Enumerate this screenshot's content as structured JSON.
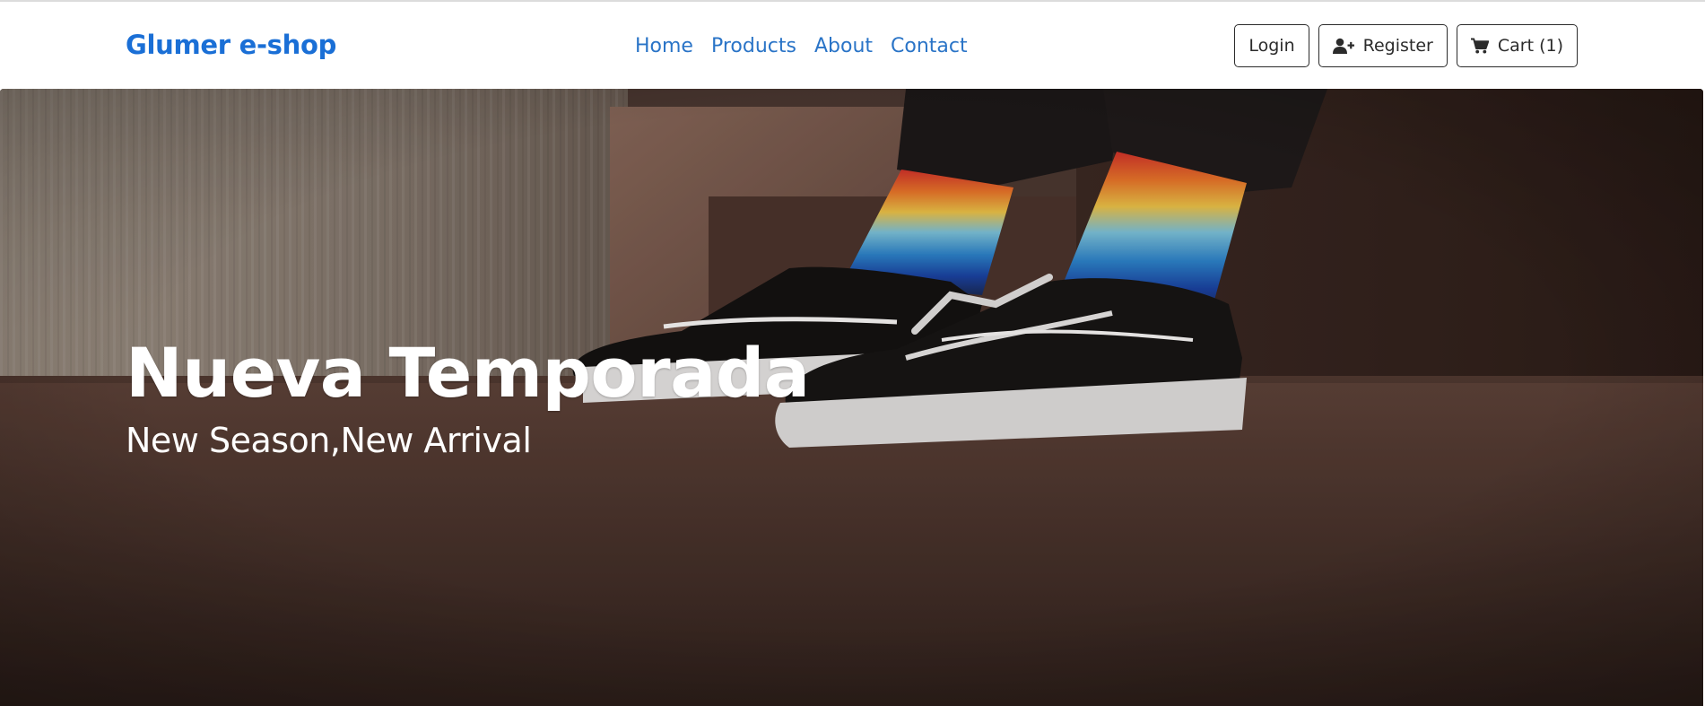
{
  "navbar": {
    "brand": "Glumer e-shop",
    "links": [
      "Home",
      "Products",
      "About",
      "Contact"
    ],
    "login_label": "Login",
    "register_label": "Register",
    "cart_label": "Cart (1)"
  },
  "hero": {
    "title": "Nueva Temporada",
    "subtitle": "New Season,New Arrival"
  },
  "colors": {
    "brand": "#1a6fd6",
    "link": "#2a74c7",
    "button_border": "#2b2b2b",
    "hero_text": "#ffffff"
  },
  "icons": {
    "register": "user-plus-icon",
    "cart": "cart-icon"
  }
}
